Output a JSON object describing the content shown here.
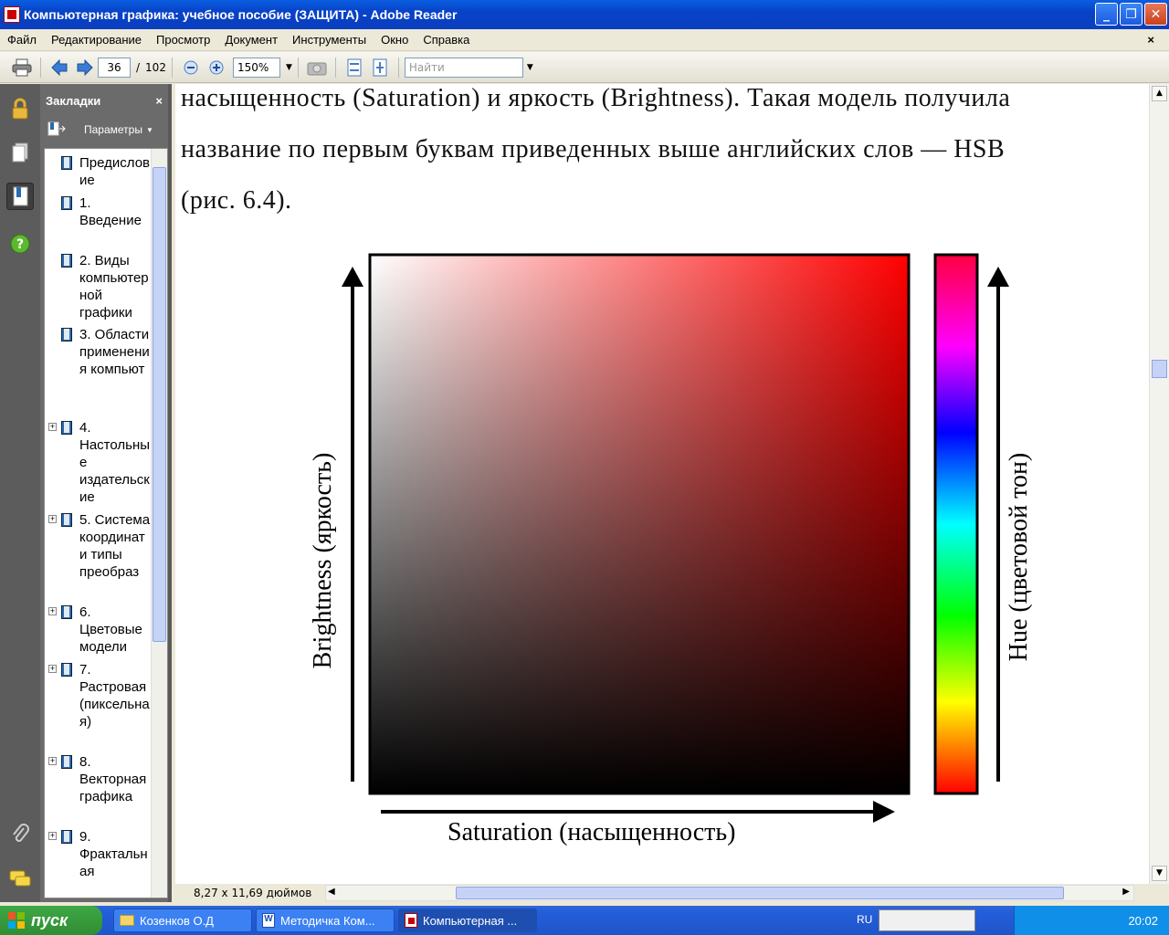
{
  "window": {
    "title": "Компьютерная графика: учебное пособие (ЗАЩИТА) - Adobe Reader"
  },
  "menu": [
    "Файл",
    "Редактирование",
    "Просмотр",
    "Документ",
    "Инструменты",
    "Окно",
    "Справка"
  ],
  "toolbar": {
    "page": "36",
    "page_sep": "/",
    "page_total": "102",
    "zoom": "150%",
    "find_placeholder": "Найти"
  },
  "bookmarks": {
    "title": "Закладки",
    "options_label": "Параметры",
    "items": [
      {
        "label": "Предисловие",
        "expandable": false
      },
      {
        "label": "1. Введение",
        "expandable": false
      },
      {
        "label": "2. Виды компьютерной графики",
        "expandable": false
      },
      {
        "label": "3. Области применения компьют",
        "expandable": false
      },
      {
        "label": "4. Настольные издательские",
        "expandable": true
      },
      {
        "label": "5. Система координат и типы преобраз",
        "expandable": true
      },
      {
        "label": "6. Цветовые модели",
        "expandable": true
      },
      {
        "label": "7. Растровая (пиксельная)",
        "expandable": true
      },
      {
        "label": "8. Векторная графика",
        "expandable": true
      },
      {
        "label": "9. Фрактальная",
        "expandable": true
      }
    ]
  },
  "document": {
    "line1": "насыщенность (Saturation) и яркость (Brightness). Такая модель получила",
    "line2": "название по первым буквам приведенных выше английских слов — HSB",
    "line3": "(рис. 6.4).",
    "figure": {
      "x_label": "Saturation (насыщенность)",
      "y_label": "Brightness (яркость)",
      "hue_label": "Hue (цветовой тон)"
    }
  },
  "status": {
    "page_size": "8,27 x 11,69 дюймов"
  },
  "taskbar": {
    "start": "пуск",
    "tasks": [
      "Козенков О.Д",
      "Методичка Ком...",
      "Компьютерная ..."
    ],
    "lang": "RU",
    "clock": "20:02"
  }
}
